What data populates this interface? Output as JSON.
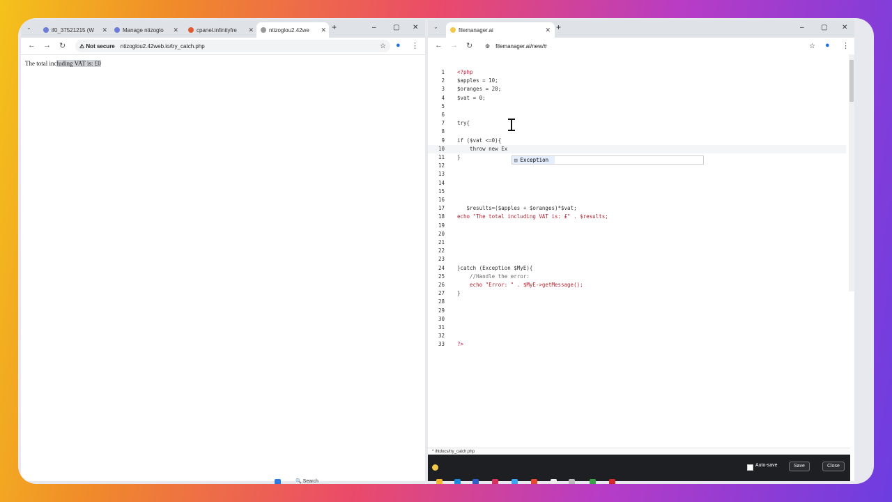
{
  "left_browser": {
    "tabs": [
      {
        "label": "if0_37521215 (W",
        "active": false
      },
      {
        "label": "Manage ntizoglo",
        "active": false
      },
      {
        "label": "cpanel.infinityfre",
        "active": false
      },
      {
        "label": "ntizoglou2.42we",
        "active": true
      }
    ],
    "new_tab": "+",
    "security_label": "Not secure",
    "url": "ntizoglou2.42web.io/try_catch.php",
    "page_text_prefix": "The total inc",
    "page_text_selected": "luding VAT is: £0"
  },
  "right_browser": {
    "tab_label": "filemanager.ai",
    "new_tab": "+",
    "url": "filemanager.ai/new/#",
    "code_lines": [
      {
        "n": "1",
        "text": "<?php",
        "cls": "tag"
      },
      {
        "n": "2",
        "text": "$apples = 10;",
        "cls": "var"
      },
      {
        "n": "3",
        "text": "$oranges = 20;",
        "cls": "var"
      },
      {
        "n": "4",
        "text": "$vat = 0;",
        "cls": "var"
      },
      {
        "n": "5",
        "text": "",
        "cls": "k"
      },
      {
        "n": "6",
        "text": "",
        "cls": "k"
      },
      {
        "n": "7",
        "text": "try{",
        "cls": "k"
      },
      {
        "n": "8",
        "text": "",
        "cls": "k"
      },
      {
        "n": "9",
        "text": "if ($vat <=0){",
        "cls": "k"
      },
      {
        "n": "10",
        "text": "    throw new Ex",
        "cls": "k"
      },
      {
        "n": "11",
        "text": "}",
        "cls": "k"
      },
      {
        "n": "12",
        "text": "",
        "cls": "k"
      },
      {
        "n": "13",
        "text": "",
        "cls": "k"
      },
      {
        "n": "14",
        "text": "",
        "cls": "k"
      },
      {
        "n": "15",
        "text": "",
        "cls": "k"
      },
      {
        "n": "16",
        "text": "",
        "cls": "k"
      },
      {
        "n": "17",
        "text": "   $results=($apples + $oranges)*$vat;",
        "cls": "var"
      },
      {
        "n": "18",
        "text": "echo \"The total including VAT is: £\" . $results;",
        "cls": "str"
      },
      {
        "n": "19",
        "text": "",
        "cls": "k"
      },
      {
        "n": "20",
        "text": "",
        "cls": "k"
      },
      {
        "n": "21",
        "text": "",
        "cls": "k"
      },
      {
        "n": "22",
        "text": "",
        "cls": "k"
      },
      {
        "n": "23",
        "text": "",
        "cls": "k"
      },
      {
        "n": "24",
        "text": "}catch (Exception $MyE){",
        "cls": "k"
      },
      {
        "n": "25",
        "text": "    //Handle the error:",
        "cls": "cmt"
      },
      {
        "n": "26",
        "text": "    echo \"Error: \" . $MyE->getMessage();",
        "cls": "str"
      },
      {
        "n": "27",
        "text": "}",
        "cls": "k"
      },
      {
        "n": "28",
        "text": "",
        "cls": "k"
      },
      {
        "n": "29",
        "text": "",
        "cls": "k"
      },
      {
        "n": "30",
        "text": "",
        "cls": "k"
      },
      {
        "n": "31",
        "text": "",
        "cls": "k"
      },
      {
        "n": "32",
        "text": "",
        "cls": "k"
      },
      {
        "n": "33",
        "text": "?>",
        "cls": "tag"
      }
    ],
    "autocomplete_item": "Exception",
    "file_path": "* /htdocs/try_catch.php",
    "autosave_label": "Auto-save",
    "save_label": "Save",
    "close_label": "Close"
  },
  "taskbar": {
    "search_label": "Search"
  }
}
